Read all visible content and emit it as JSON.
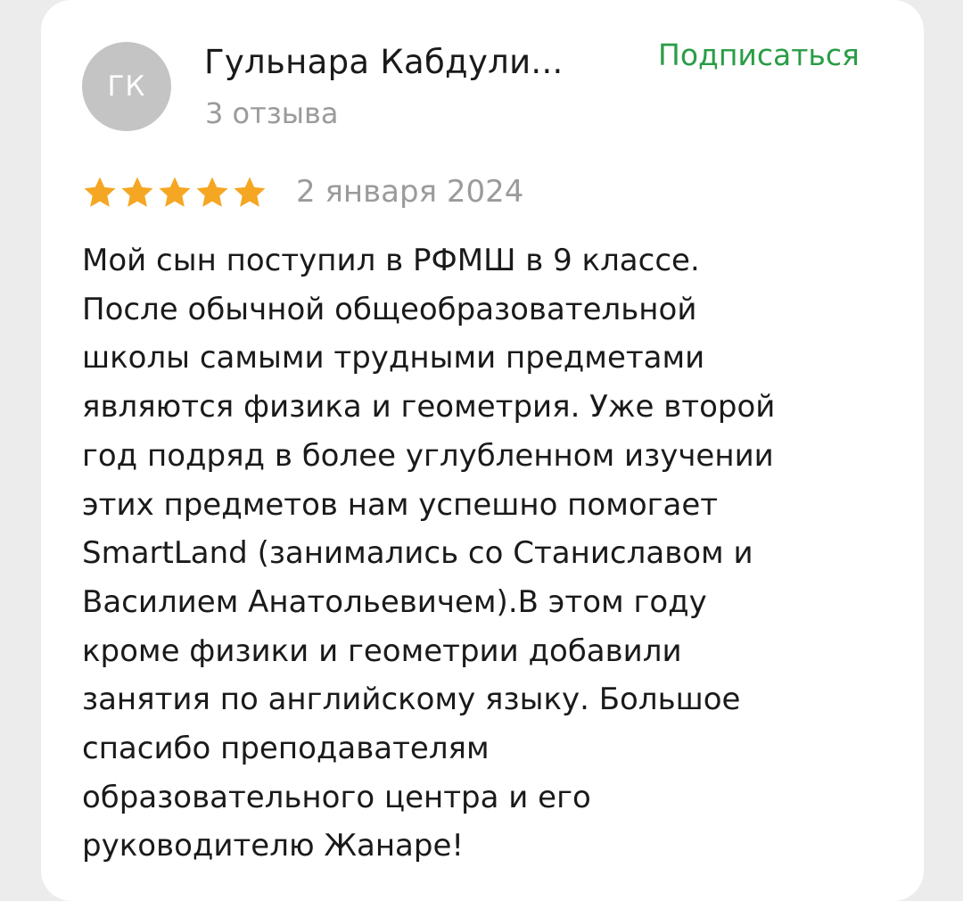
{
  "author": {
    "initials": "ГК",
    "name": "Гульнара Кабдули...",
    "reviews_count": "3 отзыва"
  },
  "subscribe_label": "Подписаться",
  "rating": {
    "stars": 5,
    "max": 5
  },
  "date": "2 января 2024",
  "review_lines": [
    "Мой сын поступил в РФМШ в 9 классе.",
    "После обычной общеобразовательной",
    "школы самыми трудными предметами",
    "являются физика и геометрия. Уже второй",
    "год подряд в более углубленном изучении",
    "этих предметов нам успешно помогает",
    "SmartLand (занимались со Станиславом и",
    "Василием Анатольевичем).В этом году",
    "кроме физики и геометрии добавили",
    "занятия по английскому языку. Большое",
    "спасибо преподавателям",
    "образовательного центра и его",
    "руководителю Жанаре!"
  ],
  "colors": {
    "star": "#f5a623",
    "accent": "#2a9d45",
    "muted": "#9b9b9b",
    "avatar_bg": "#c4c4c4"
  }
}
